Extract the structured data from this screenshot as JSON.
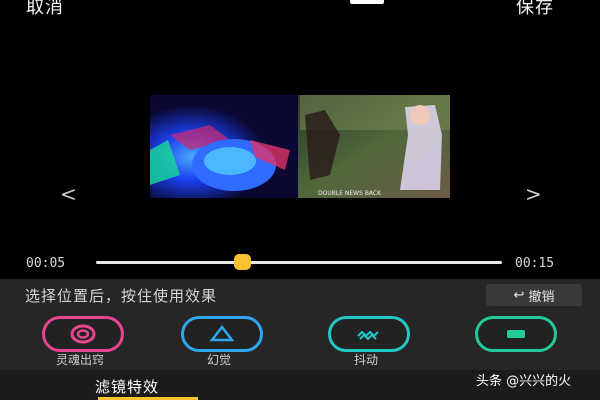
{
  "header": {
    "cancel_label": "取消",
    "save_label": "保存"
  },
  "preview": {
    "caption": "DOUBLE NEWS BACK"
  },
  "player": {
    "current_time": "00:05",
    "total_time": "00:15",
    "progress": 0.36
  },
  "effects": {
    "hint": "选择位置后，按住使用效果",
    "undo_label": "撤销",
    "items": [
      {
        "label": "灵魂出窍",
        "color": "#e8458f",
        "icon": "ring-icon"
      },
      {
        "label": "幻觉",
        "color": "#2fa6f0",
        "icon": "triangle-icon"
      },
      {
        "label": "抖动",
        "color": "#20c7c7",
        "icon": "wave-icon"
      },
      {
        "label": "",
        "color": "#22c99a",
        "icon": "bar-icon"
      }
    ]
  },
  "bottom": {
    "tab_label": "滤镜特效"
  },
  "watermark": {
    "platform": "头条",
    "account": "@兴兴的火"
  }
}
